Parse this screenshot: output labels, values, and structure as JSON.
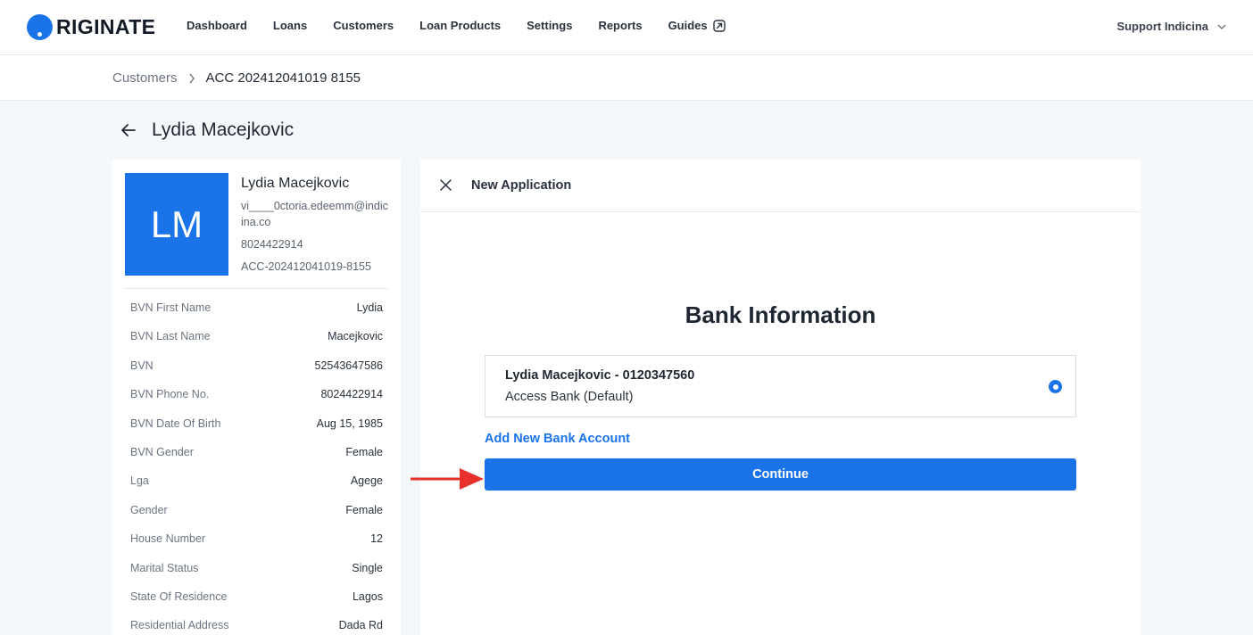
{
  "brand": {
    "name": "RIGINATE",
    "accent": "#1a73e8"
  },
  "nav": {
    "items": [
      "Dashboard",
      "Loans",
      "Customers",
      "Loan Products",
      "Settings",
      "Reports"
    ],
    "guides": "Guides"
  },
  "user_menu": {
    "label": "Support Indicina"
  },
  "breadcrumb": {
    "parent": "Customers",
    "current": "ACC 202412041019 8155"
  },
  "page": {
    "title": "Lydia Macejkovic"
  },
  "profile": {
    "initials": "LM",
    "name": "Lydia Macejkovic",
    "email": "vi____0ctoria.edeemm@indicina.co",
    "phone": "8024422914",
    "account_id": "ACC-202412041019-8155",
    "details": [
      {
        "label": "BVN First Name",
        "value": "Lydia"
      },
      {
        "label": "BVN Last Name",
        "value": "Macejkovic"
      },
      {
        "label": "BVN",
        "value": "52543647586"
      },
      {
        "label": "BVN Phone No.",
        "value": "8024422914"
      },
      {
        "label": "BVN Date Of Birth",
        "value": "Aug 15, 1985"
      },
      {
        "label": "BVN Gender",
        "value": "Female"
      },
      {
        "label": "Lga",
        "value": "Agege"
      },
      {
        "label": "Gender",
        "value": "Female"
      },
      {
        "label": "House Number",
        "value": "12"
      },
      {
        "label": "Marital Status",
        "value": "Single"
      },
      {
        "label": "State Of Residence",
        "value": "Lagos"
      },
      {
        "label": "Residential Address",
        "value": "Dada Rd"
      }
    ]
  },
  "application": {
    "title": "New Application",
    "section_title": "Bank Information",
    "bank_option": {
      "name": "Lydia Macejkovic - 0120347560",
      "bank": "Access Bank (Default)",
      "selected": true
    },
    "add_bank_label": "Add New Bank Account",
    "continue_label": "Continue"
  },
  "annotation": {
    "arrow_color": "#e8312a"
  }
}
